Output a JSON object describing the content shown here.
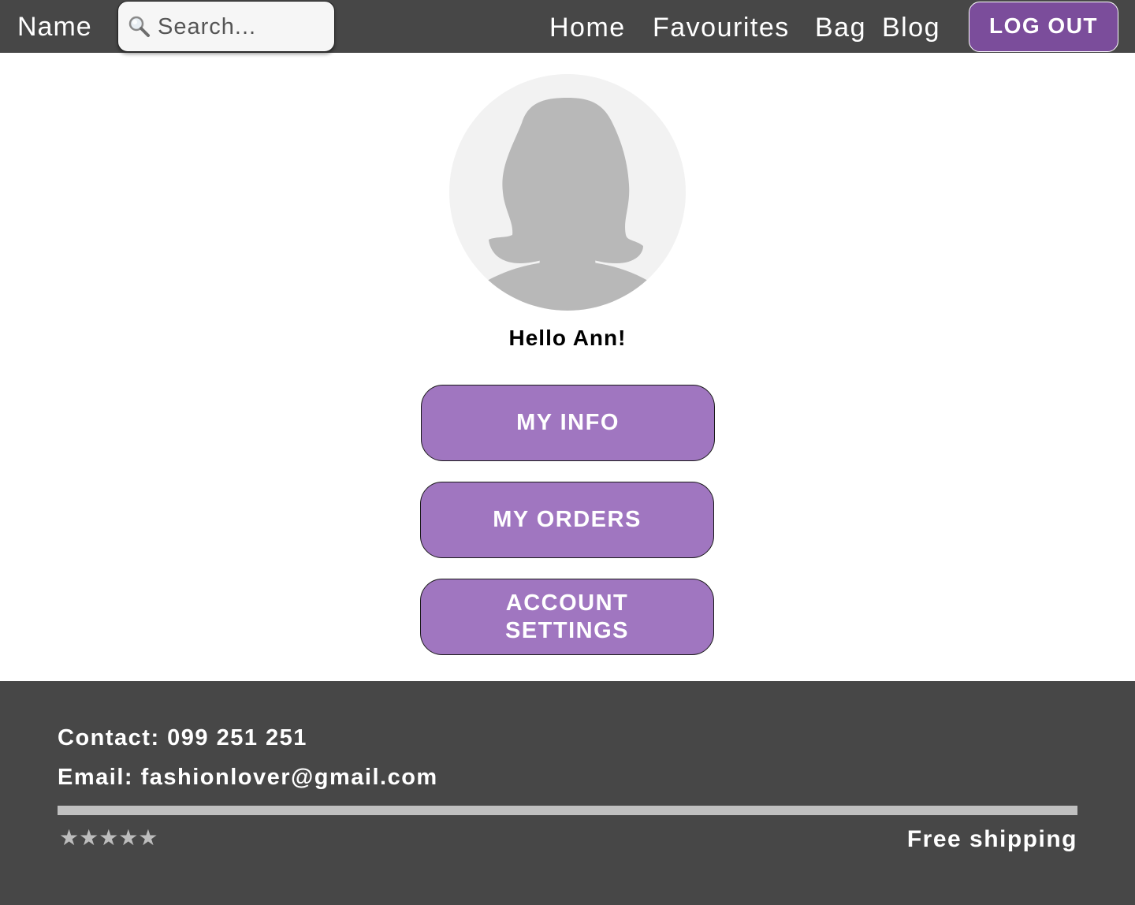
{
  "header": {
    "brand": "Name",
    "search": {
      "placeholder": "Search...",
      "icon": "search-icon"
    },
    "nav": {
      "home": "Home",
      "favourites": "Favourites",
      "bag": "Bag",
      "blog": "Blog"
    },
    "logout_label": "LOG OUT"
  },
  "profile": {
    "avatar_icon": "user-silhouette-icon",
    "greeting": "Hello Ann!"
  },
  "menu": {
    "my_info": "MY INFO",
    "my_orders": "MY ORDERS",
    "account_settings": "ACCOUNT SETTINGS"
  },
  "footer": {
    "contact": "Contact: 099 251 251",
    "email": "Email: fashionlover@gmail.com",
    "rating": {
      "icon": "star-icon",
      "stars": "★★★★★"
    },
    "shipping": "Free shipping"
  },
  "colors": {
    "header_bg": "#474747",
    "footer_bg": "#474747",
    "accent_dark": "#7b4d9b",
    "accent_button": "#a076c0",
    "avatar_bg": "#f2f2f2",
    "avatar_silhouette": "#b8b8b8",
    "divider": "#c0c0c0"
  }
}
